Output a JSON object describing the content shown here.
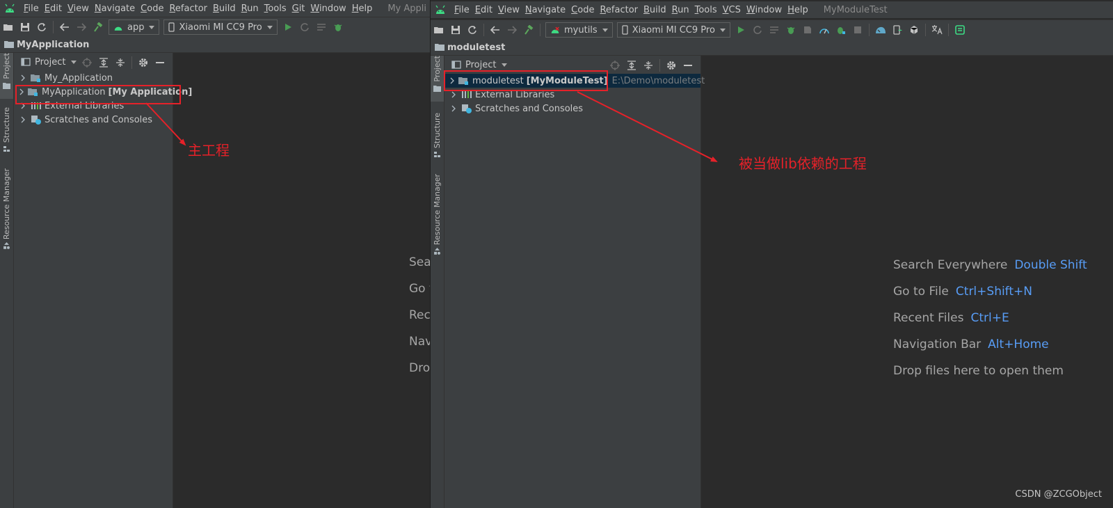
{
  "left": {
    "menu": [
      "File",
      "Edit",
      "View",
      "Navigate",
      "Code",
      "Refactor",
      "Build",
      "Run",
      "Tools",
      "Git",
      "Window",
      "Help"
    ],
    "window_title": "My Appli",
    "config_combo": "app",
    "device_combo": "Xiaomi MI CC9 Pro",
    "nav_project": "MyApplication",
    "panel_title": "Project",
    "tree": [
      {
        "name": "My_Application",
        "module": "",
        "path": ""
      },
      {
        "name": "MyApplication",
        "module": "[My Application]",
        "path": ""
      },
      {
        "name": "External Libraries",
        "module": "",
        "path": ""
      },
      {
        "name": "Scratches and Consoles",
        "module": "",
        "path": ""
      }
    ],
    "hints": [
      "Sear",
      "Go t",
      "Rec",
      "Nav",
      "Dro"
    ],
    "annotation": "主工程"
  },
  "right": {
    "menu": [
      "File",
      "Edit",
      "View",
      "Navigate",
      "Code",
      "Refactor",
      "Build",
      "Run",
      "Tools",
      "VCS",
      "Window",
      "Help"
    ],
    "window_title": "MyModuleTest",
    "config_combo": "myutils",
    "device_combo": "Xiaomi MI CC9 Pro",
    "nav_project": "moduletest",
    "panel_title": "Project",
    "tree": [
      {
        "name": "moduletest",
        "module": "[MyModuleTest]",
        "path": "E:\\Demo\\moduletest"
      },
      {
        "name": "External Libraries",
        "module": "",
        "path": ""
      },
      {
        "name": "Scratches and Consoles",
        "module": "",
        "path": ""
      }
    ],
    "hints": [
      {
        "label": "Search Everywhere",
        "shortcut": "Double Shift"
      },
      {
        "label": "Go to File",
        "shortcut": "Ctrl+Shift+N"
      },
      {
        "label": "Recent Files",
        "shortcut": "Ctrl+E"
      },
      {
        "label": "Navigation Bar",
        "shortcut": "Alt+Home"
      },
      {
        "label": "Drop files here to open them",
        "shortcut": ""
      }
    ],
    "annotation": "被当做lib依赖的工程"
  },
  "side_tabs": {
    "project": "Project",
    "structure": "Structure",
    "resource_manager": "Resource Manager"
  },
  "watermark": "CSDN @ZCGObject",
  "colors": {
    "annotation_red": "#e62129",
    "shortcut_blue": "#589df6",
    "android_green": "#3ddc84",
    "run_green": "#499c54",
    "selection": "#0d293e"
  }
}
